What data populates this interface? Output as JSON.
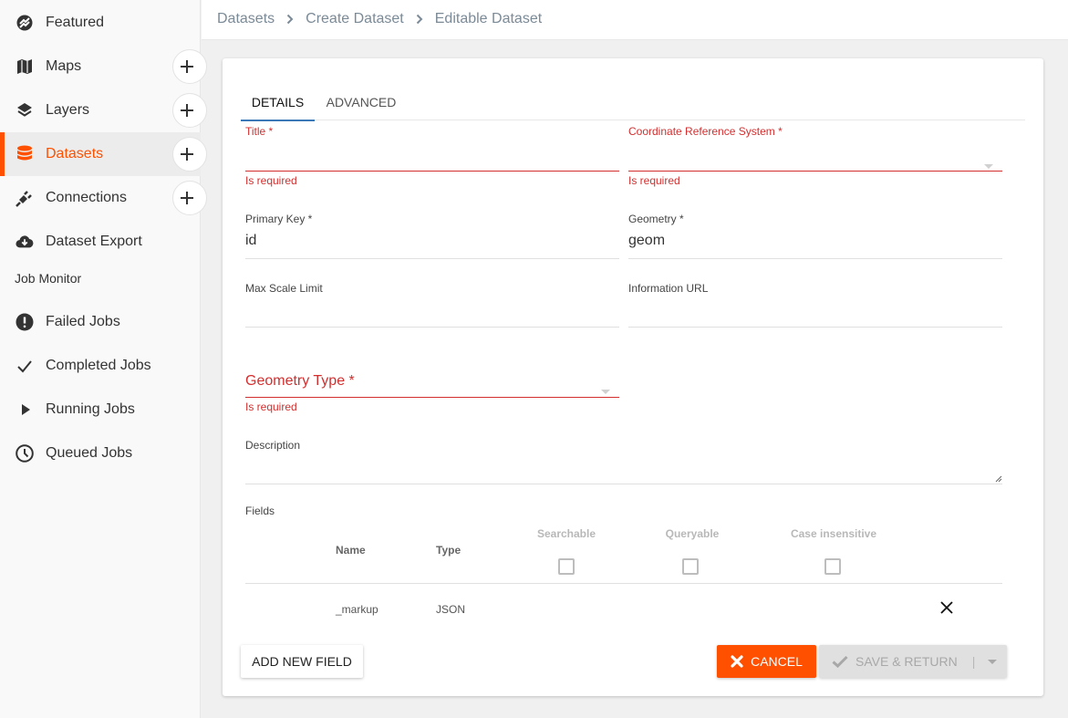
{
  "sidebar": {
    "items": [
      {
        "label": "Featured",
        "icon": "featured-icon",
        "has_add": false,
        "active": false
      },
      {
        "label": "Maps",
        "icon": "map-icon",
        "has_add": true,
        "active": false
      },
      {
        "label": "Layers",
        "icon": "layers-icon",
        "has_add": true,
        "active": false
      },
      {
        "label": "Datasets",
        "icon": "database-icon",
        "has_add": true,
        "active": true
      },
      {
        "label": "Connections",
        "icon": "plug-icon",
        "has_add": true,
        "active": false
      },
      {
        "label": "Dataset Export",
        "icon": "cloud-download-icon",
        "has_add": false,
        "active": false
      }
    ],
    "job_monitor_label": "Job Monitor",
    "jobs": [
      {
        "label": "Failed Jobs",
        "icon": "exclamation-circle-icon"
      },
      {
        "label": "Completed Jobs",
        "icon": "check-icon"
      },
      {
        "label": "Running Jobs",
        "icon": "play-icon"
      },
      {
        "label": "Queued Jobs",
        "icon": "clock-icon"
      }
    ],
    "add_symbol": "+"
  },
  "breadcrumb": [
    "Datasets",
    "Create Dataset",
    "Editable Dataset"
  ],
  "tabs": [
    {
      "label": "DETAILS",
      "active": true
    },
    {
      "label": "ADVANCED",
      "active": false
    }
  ],
  "form": {
    "title": {
      "label": "Title *",
      "value": "",
      "error": "Is required"
    },
    "crs": {
      "label": "Coordinate Reference System *",
      "value": "",
      "error": "Is required"
    },
    "primary_key": {
      "label": "Primary Key *",
      "value": "id"
    },
    "geometry": {
      "label": "Geometry *",
      "value": "geom"
    },
    "max_scale": {
      "label": "Max Scale Limit",
      "value": ""
    },
    "info_url": {
      "label": "Information URL",
      "value": ""
    },
    "geometry_type": {
      "label": "Geometry Type *",
      "value": "",
      "error": "Is required"
    },
    "description": {
      "label": "Description",
      "value": ""
    }
  },
  "fields_table": {
    "label": "Fields",
    "columns": {
      "name": "Name",
      "type": "Type",
      "searchable": "Searchable",
      "queryable": "Queryable",
      "case_insensitive": "Case insensitive"
    },
    "header_checks": {
      "searchable": false,
      "queryable": false,
      "case_insensitive": false
    },
    "rows": [
      {
        "name": "_markup",
        "type": "JSON"
      }
    ]
  },
  "buttons": {
    "add_field": "ADD NEW FIELD",
    "cancel": "CANCEL",
    "save": "SAVE & RETURN",
    "save_divider": "|"
  },
  "colors": {
    "accent": "#ff5000",
    "error": "#d32f2f",
    "tab_indicator": "#3b78b8"
  }
}
